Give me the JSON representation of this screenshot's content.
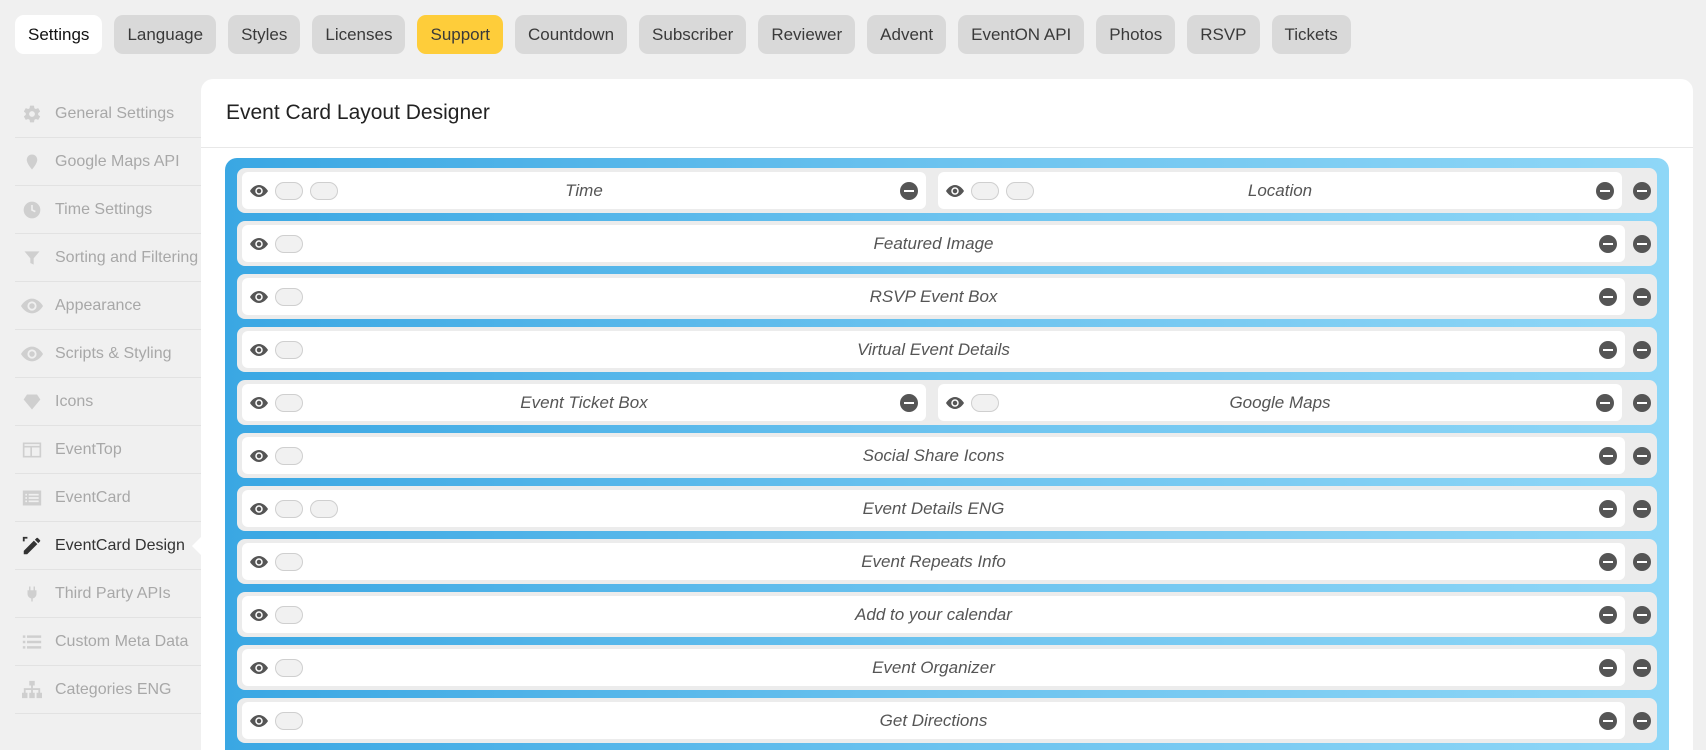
{
  "tabs": [
    {
      "label": "Settings",
      "state": "active"
    },
    {
      "label": "Language",
      "state": ""
    },
    {
      "label": "Styles",
      "state": ""
    },
    {
      "label": "Licenses",
      "state": ""
    },
    {
      "label": "Support",
      "state": "highlight"
    },
    {
      "label": "Countdown",
      "state": ""
    },
    {
      "label": "Subscriber",
      "state": ""
    },
    {
      "label": "Reviewer",
      "state": ""
    },
    {
      "label": "Advent",
      "state": ""
    },
    {
      "label": "EventON API",
      "state": ""
    },
    {
      "label": "Photos",
      "state": ""
    },
    {
      "label": "RSVP",
      "state": ""
    },
    {
      "label": "Tickets",
      "state": ""
    }
  ],
  "sidebar": {
    "items": [
      {
        "label": "General Settings",
        "icon": "gear-icon",
        "active": false
      },
      {
        "label": "Google Maps API",
        "icon": "map-pin-icon",
        "active": false
      },
      {
        "label": "Time Settings",
        "icon": "clock-icon",
        "active": false
      },
      {
        "label": "Sorting and Filtering",
        "icon": "filter-icon",
        "active": false
      },
      {
        "label": "Appearance",
        "icon": "eye-icon",
        "active": false
      },
      {
        "label": "Scripts & Styling",
        "icon": "eye-icon",
        "active": false
      },
      {
        "label": "Icons",
        "icon": "diamond-icon",
        "active": false
      },
      {
        "label": "EventTop",
        "icon": "layout-icon",
        "active": false
      },
      {
        "label": "EventCard",
        "icon": "list-card-icon",
        "active": false
      },
      {
        "label": "EventCard Design",
        "icon": "design-tools-icon",
        "active": true
      },
      {
        "label": "Third Party APIs",
        "icon": "plug-icon",
        "active": false
      },
      {
        "label": "Custom Meta Data",
        "icon": "list-icon",
        "active": false
      },
      {
        "label": "Categories ENG",
        "icon": "sitemap-icon",
        "active": false
      }
    ]
  },
  "panel": {
    "title": "Event Card Layout Designer"
  },
  "designer": {
    "rows": [
      {
        "cells": [
          {
            "label": "Time",
            "toggles": 2,
            "minus": true
          },
          {
            "label": "Location",
            "toggles": 2,
            "minus": true
          }
        ]
      },
      {
        "cells": [
          {
            "label": "Featured Image",
            "toggles": 1,
            "minus": true
          }
        ]
      },
      {
        "cells": [
          {
            "label": "RSVP Event Box",
            "toggles": 1,
            "minus": true
          }
        ]
      },
      {
        "cells": [
          {
            "label": "Virtual Event Details",
            "toggles": 1,
            "minus": true
          }
        ]
      },
      {
        "cells": [
          {
            "label": "Event Ticket Box",
            "toggles": 1,
            "minus": true
          },
          {
            "label": "Google Maps",
            "toggles": 1,
            "minus": true
          }
        ]
      },
      {
        "cells": [
          {
            "label": "Social Share Icons",
            "toggles": 1,
            "minus": true
          }
        ]
      },
      {
        "cells": [
          {
            "label": "Event Details ENG",
            "toggles": 2,
            "minus": true
          }
        ]
      },
      {
        "cells": [
          {
            "label": "Event Repeats Info",
            "toggles": 1,
            "minus": true
          }
        ]
      },
      {
        "cells": [
          {
            "label": "Add to your calendar",
            "toggles": 1,
            "minus": true
          }
        ]
      },
      {
        "cells": [
          {
            "label": "Event Organizer",
            "toggles": 1,
            "minus": true
          }
        ]
      },
      {
        "cells": [
          {
            "label": "Get Directions",
            "toggles": 1,
            "minus": true
          }
        ]
      }
    ]
  }
}
